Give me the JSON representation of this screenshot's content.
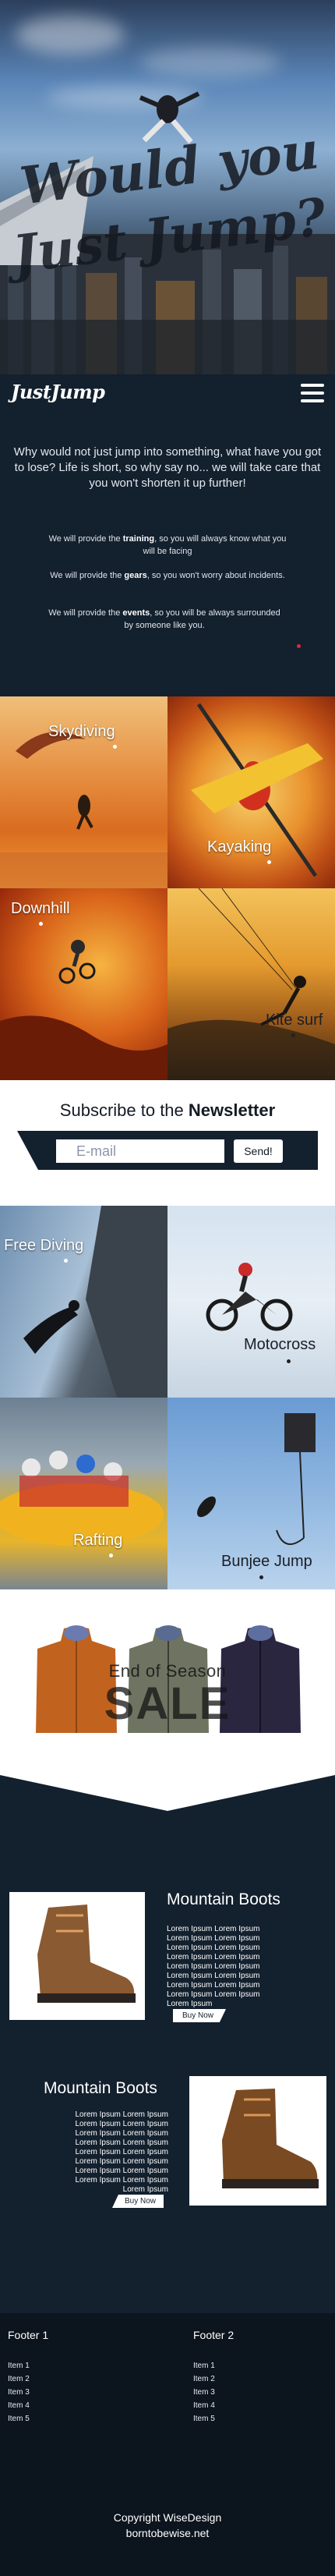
{
  "hero": {
    "title_line1": "Would you",
    "title_line2": "Just Jump?"
  },
  "nav": {
    "logo": "JustJump",
    "menu_icon": "hamburger-icon"
  },
  "intro": {
    "lead": "Why would not just jump into something, what have you got to lose? Life is short, so why say no... we will take care that you won't shorten it up further!",
    "p1_pre": "We will provide the ",
    "p1_bold": "training",
    "p1_post": ", so you will always know what you will be facing",
    "p2_pre": "We will provide the ",
    "p2_bold": "gears",
    "p2_post": ", so you won't worry about incidents.",
    "p3_pre": "We will provide the ",
    "p3_bold": "events",
    "p3_post": ", so you will be always surrounded by someone like you."
  },
  "activities_1": [
    {
      "label": "Skydiving"
    },
    {
      "label": "Kayaking"
    },
    {
      "label": "Downhill"
    },
    {
      "label": "Kite surf"
    }
  ],
  "newsletter": {
    "title_pre": "Subscribe to the ",
    "title_bold": "Newsletter",
    "email_placeholder": "E-mail",
    "send_label": "Send!"
  },
  "activities_2": [
    {
      "label": "Free Diving"
    },
    {
      "label": "Motocross"
    },
    {
      "label": "Rafting"
    },
    {
      "label": "Bunjee Jump"
    }
  ],
  "sale": {
    "line1": "End of Season",
    "line2": "SALE"
  },
  "products": [
    {
      "title": "Mountain Boots",
      "description": "Lorem Ipsum Lorem Ipsum Lorem Ipsum Lorem Ipsum Lorem Ipsum Lorem Ipsum Lorem Ipsum Lorem Ipsum Lorem Ipsum Lorem Ipsum Lorem Ipsum Lorem Ipsum Lorem Ipsum Lorem Ipsum Lorem Ipsum Lorem Ipsum Lorem Ipsum",
      "button": "Buy Now"
    },
    {
      "title": "Mountain Boots",
      "description": "Lorem Ipsum Lorem Ipsum Lorem Ipsum Lorem Ipsum Lorem Ipsum Lorem Ipsum Lorem Ipsum Lorem Ipsum Lorem Ipsum Lorem Ipsum Lorem Ipsum Lorem Ipsum Lorem Ipsum Lorem Ipsum Lorem Ipsum Lorem Ipsum Lorem Ipsum",
      "button": "Buy Now"
    }
  ],
  "footer": {
    "col1": {
      "title": "Footer 1",
      "items": [
        "Item 1",
        "Item 2",
        "Item 3",
        "Item 4",
        "Item 5"
      ]
    },
    "col2": {
      "title": "Footer 2",
      "items": [
        "Item 1",
        "Item 2",
        "Item 3",
        "Item 4",
        "Item 5"
      ]
    },
    "copyright": "Copyright WiseDesign",
    "site": "borntobewise.net"
  },
  "colors": {
    "navy": "#13202e",
    "footer": "#0c141d",
    "accent_red": "#e0283c"
  }
}
